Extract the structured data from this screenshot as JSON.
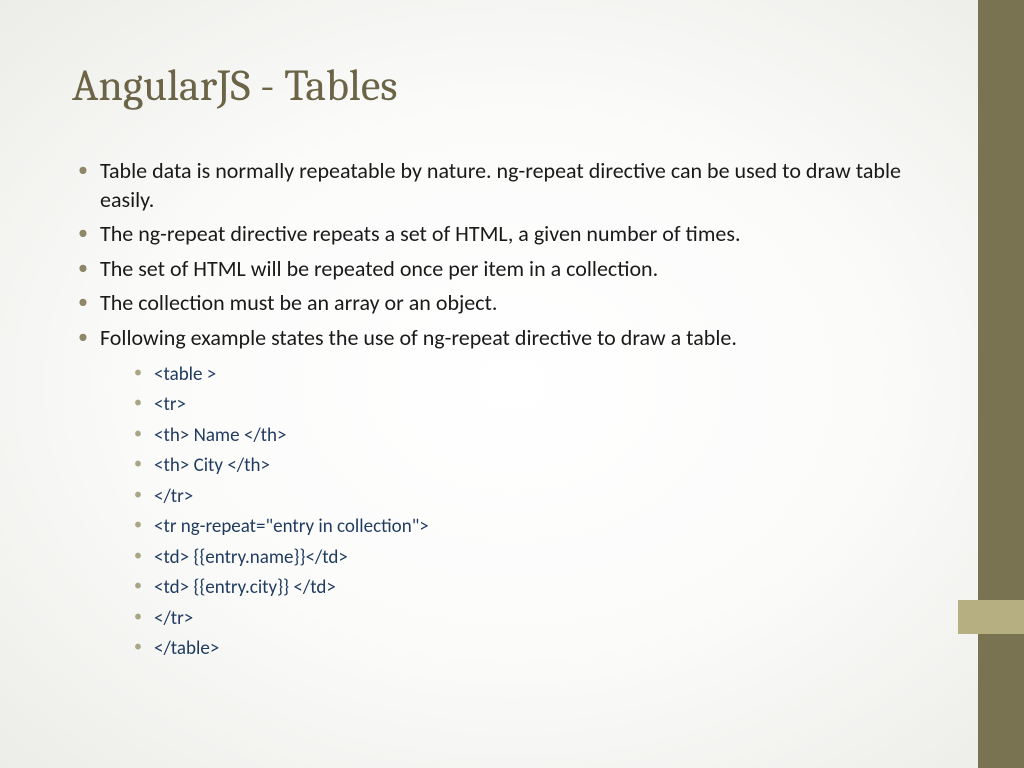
{
  "title": "AngularJS - Tables",
  "bullets": [
    "Table data is normally repeatable by nature. ng-repeat directive can be used to draw table easily.",
    "The ng-repeat directive repeats a set of HTML, a given number of times.",
    "The set of HTML will be repeated once per item in a collection.",
    "The collection must be an array or an object.",
    "Following example states the use of ng-repeat directive to draw a table."
  ],
  "code": [
    "<table >",
    "<tr>",
    "<th> Name </th>",
    "<th> City </th>",
    "</tr>",
    "<tr ng-repeat=\"entry in collection\">",
    "<td> {{entry.name}}</td>",
    "<td> {{entry.city}} </td>",
    "</tr>",
    "</table>"
  ]
}
